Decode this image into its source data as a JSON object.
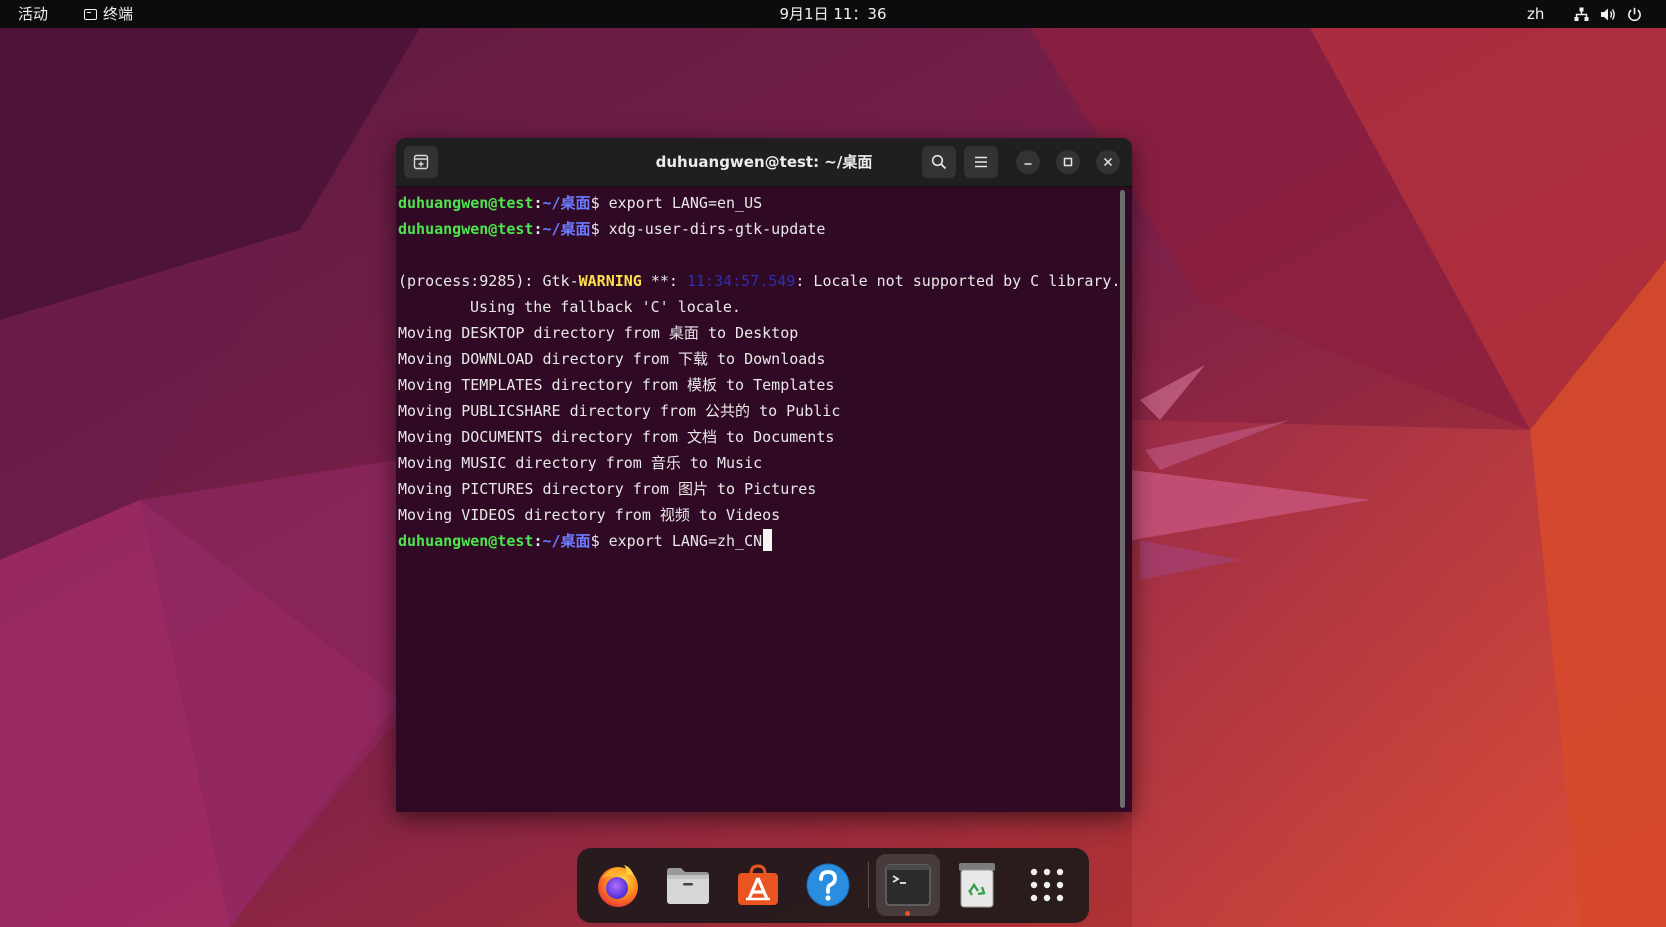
{
  "topbar": {
    "activities": "活动",
    "app_name": "终端",
    "clock": "9月1日  11：36",
    "input_language": "zh",
    "tray_icons": [
      "network-icon",
      "volume-icon",
      "power-icon"
    ]
  },
  "terminal": {
    "title": "duhuangwen@test: ~/桌面",
    "prompt": {
      "user": "duhuangwen@test",
      "colon": ":",
      "path": "~/桌面",
      "symbol": "$ "
    },
    "lines": {
      "cmd1": "export LANG=en_US",
      "cmd2": "xdg-user-dirs-gtk-update",
      "warn_prefix": "(process:9285): Gtk-",
      "warn_word": "WARNING",
      "warn_mid": " **: ",
      "warn_time": "11:34:57.549",
      "warn_tail": ": Locale not supported by C library.",
      "warn_cont": "Using the fallback 'C' locale.",
      "move_desktop": "Moving DESKTOP directory from 桌面 to Desktop",
      "move_download": "Moving DOWNLOAD directory from 下载 to Downloads",
      "move_templates": "Moving TEMPLATES directory from 模板 to Templates",
      "move_publicshare": "Moving PUBLICSHARE directory from 公共的 to Public",
      "move_documents": "Moving DOCUMENTS directory from 文档 to Documents",
      "move_music": "Moving MUSIC directory from 音乐 to Music",
      "move_pictures": "Moving PICTURES directory from 图片 to Pictures",
      "move_videos": "Moving VIDEOS directory from 视频 to Videos",
      "cmd3": "export LANG=zh_CN"
    }
  },
  "dock": {
    "items": [
      "firefox-icon",
      "files-icon",
      "app-store-icon",
      "help-icon",
      "terminal-icon",
      "trash-icon",
      "show-apps-icon"
    ],
    "running": "terminal"
  },
  "colors": {
    "topbar_bg": "#0c0c0c",
    "terminal_bg": "#300a24",
    "prompt_user": "#4ee44e",
    "prompt_path": "#6d7cff",
    "warning": "#ffe14d",
    "accent": "#e95420"
  }
}
